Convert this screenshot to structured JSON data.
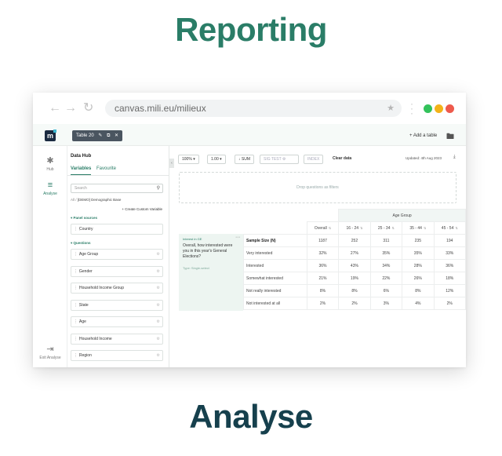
{
  "hero": {
    "top_title": "Reporting",
    "bottom_title": "Analyse"
  },
  "browser": {
    "url": "canvas.mili.eu/milieux",
    "colors": {
      "green": "#33c25b",
      "yellow": "#f3b319",
      "red": "#ee5a4c"
    }
  },
  "header": {
    "table_tab": "Table 20",
    "add_table": "+ Add a table"
  },
  "rail": {
    "hub": "Hub",
    "analyse": "Analyse",
    "exit": "Exit Analyse"
  },
  "hub": {
    "title": "Data Hub",
    "tab_variables": "Variables",
    "tab_favourite": "Favourite",
    "search_placeholder": "Search",
    "crumb_root": "All",
    "crumb_sep": "/",
    "crumb_current": "[DEMO] Demographic Base",
    "create_custom": "+ Create Custom Variable",
    "panel_sources_label": "Panel sources",
    "questions_label": "Questions",
    "panel_items": [
      "Country"
    ],
    "question_items": [
      "Age Group",
      "Gender",
      "Household Income Group",
      "State",
      "Age",
      "Household Income",
      "Region"
    ]
  },
  "toolbar": {
    "zoom": "100%",
    "decimals": "1.00",
    "sum": "SUM",
    "sig_test": "SIG TEST",
    "index": "INDEX",
    "clear": "Clear data",
    "updated": "Updated: 4th Aug 2023"
  },
  "dropzone": {
    "text": "Drop questions as filters"
  },
  "question_card": {
    "tag": "Interest in GE",
    "text": "Overall, how interested were you in this year's General Elections?",
    "type": "Type: Single-select"
  },
  "table": {
    "group_header": "Age Group",
    "columns": [
      "Overall",
      "16 - 24",
      "25 - 34",
      "35 - 44",
      "45 - 54"
    ],
    "rows": [
      {
        "label": "Sample Size (N)",
        "values": [
          "1187",
          "252",
          "311",
          "235",
          "194"
        ],
        "bold": true
      },
      {
        "label": "Very interested",
        "values": [
          "32%",
          "27%",
          "35%",
          "35%",
          "33%"
        ]
      },
      {
        "label": "Interested",
        "values": [
          "36%",
          "43%",
          "34%",
          "28%",
          "36%"
        ]
      },
      {
        "label": "Somewhat interested",
        "values": [
          "21%",
          "19%",
          "22%",
          "26%",
          "18%"
        ]
      },
      {
        "label": "Not really interested",
        "values": [
          "8%",
          "8%",
          "6%",
          "8%",
          "12%"
        ]
      },
      {
        "label": "Not interested at all",
        "values": [
          "2%",
          "2%",
          "3%",
          "4%",
          "2%"
        ]
      }
    ]
  }
}
